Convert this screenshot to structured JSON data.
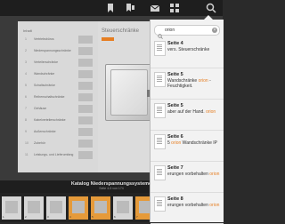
{
  "toolbar": {
    "icons": [
      "bookmark-icon",
      "bookmarks-icon",
      "mail-icon",
      "grid-icon",
      "search-icon"
    ]
  },
  "page_left": {
    "header": "Inhalt",
    "rows": [
      {
        "num": "1",
        "label": "Vertriebsbüros"
      },
      {
        "num": "2",
        "label": "Niederspannungsschränke"
      },
      {
        "num": "3",
        "label": "Verteilerschränke"
      },
      {
        "num": "4",
        "label": "Wandschränke"
      },
      {
        "num": "5",
        "label": "Schaltschränke"
      },
      {
        "num": "6",
        "label": "Reihenschaltschränke"
      },
      {
        "num": "7",
        "label": "Gehäuse"
      },
      {
        "num": "8",
        "label": "Kabelverteilerschränke"
      },
      {
        "num": "9",
        "label": "Außenschränke"
      },
      {
        "num": "10",
        "label": "Zubehör"
      },
      {
        "num": "11",
        "label": "Leistungs- und Lieferumfang"
      }
    ]
  },
  "page_right": {
    "title": "Steuerschränke"
  },
  "caption": {
    "title": "Katalog Niederspannungssysteme",
    "subtitle": "Seite 4-5 von 174"
  },
  "strip": {
    "pages": [
      "1",
      "2",
      "3",
      "4",
      "5",
      "6",
      "7",
      "8",
      "9",
      "10"
    ]
  },
  "search": {
    "value": "orion",
    "placeholder": "Suchen",
    "results": [
      {
        "title": "Seite 4",
        "pre": "vers. Steuerschränke",
        "hl": "",
        "post": ""
      },
      {
        "title": "Seite 5",
        "pre": "Wandschränke ",
        "hl": "orion",
        "post": " - Feuchtigkeit."
      },
      {
        "title": "Seite 5",
        "pre": "aber auf der Hand. ",
        "hl": "orion",
        "post": ""
      },
      {
        "title": "Seite 6",
        "pre": "5 ",
        "hl": "orion",
        "post": " Wandschränke IP"
      },
      {
        "title": "Seite 7",
        "pre": "erungen vorbehalten ",
        "hl": "orion",
        "post": ""
      },
      {
        "title": "Seite 8",
        "pre": "erungen vorbehalten ",
        "hl": "orion",
        "post": ""
      }
    ]
  }
}
